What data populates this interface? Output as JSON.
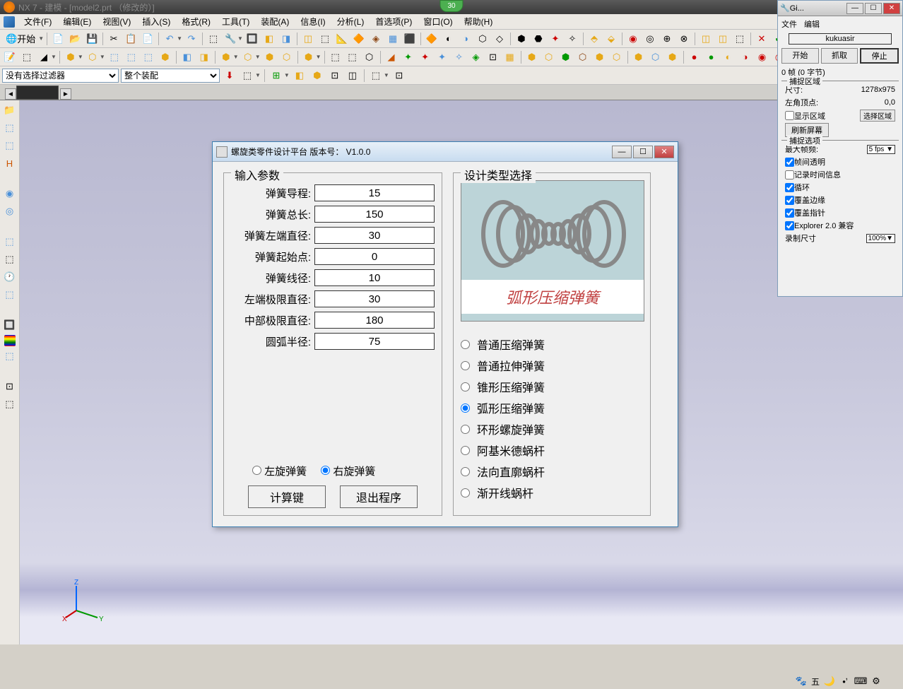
{
  "app": {
    "title": "NX 7 - 建模 - [model2.prt （修改的）]",
    "badge": "30"
  },
  "menu": [
    "文件(F)",
    "编辑(E)",
    "视图(V)",
    "插入(S)",
    "格式(R)",
    "工具(T)",
    "装配(A)",
    "信息(I)",
    "分析(L)",
    "首选项(P)",
    "窗口(O)",
    "帮助(H)"
  ],
  "startLabel": "开始",
  "filter": {
    "noSelection": "没有选择过滤器",
    "assembly": "整个装配"
  },
  "dialog": {
    "title": "螺旋类零件设计平台 版本号： V1.0.0",
    "inputGroup": "输入参数",
    "typeGroup": "设计类型选择",
    "params": [
      {
        "label": "弹簧导程:",
        "value": "15"
      },
      {
        "label": "弹簧总长:",
        "value": "150"
      },
      {
        "label": "弹簧左端直径:",
        "value": "30"
      },
      {
        "label": "弹簧起始点:",
        "value": "0"
      },
      {
        "label": "弹簧线径:",
        "value": "10"
      },
      {
        "label": "左端极限直径:",
        "value": "30"
      },
      {
        "label": "中部极限直径:",
        "value": "180"
      },
      {
        "label": "圆弧半径:",
        "value": "75"
      }
    ],
    "leftSpin": "左旋弹簧",
    "rightSpin": "右旋弹簧",
    "calcBtn": "计算键",
    "exitBtn": "退出程序",
    "previewCaption": "弧形压缩弹簧",
    "types": [
      "普通压缩弹簧",
      "普通拉伸弹簧",
      "锥形压缩弹簧",
      "弧形压缩弹簧",
      "环形螺旋弹簧",
      "阿基米德蜗杆",
      "法向直廓蜗杆",
      "渐开线蜗杆"
    ],
    "selectedType": 3
  },
  "capture": {
    "title": "Gi...",
    "menuFile": "文件",
    "menuEdit": "编辑",
    "username": "kukuasir",
    "start": "开始",
    "grab": "抓取",
    "stop": "停止",
    "frameInfo": "0 帧 (0 字节)",
    "regionGroup": "捕捉区域",
    "sizeLabel": "尺寸:",
    "sizeValue": "1278x975",
    "cornerLabel": "左角顶点:",
    "cornerValue": "0,0",
    "showRegion": "显示区域",
    "selectRegion": "选择区域",
    "refresh": "刷新屏幕",
    "optionsGroup": "捕捉选项",
    "maxFpsLabel": "最大帧频:",
    "maxFpsValue": "5 fps",
    "opt1": "帧间透明",
    "opt2": "记录时间信息",
    "opt3": "循环",
    "opt4": "覆盖边缘",
    "opt5": "覆盖指针",
    "opt6": "Explorer 2.0 兼容",
    "recSizeLabel": "录制尺寸",
    "recSizeValue": "100%"
  },
  "statusIME": "五"
}
